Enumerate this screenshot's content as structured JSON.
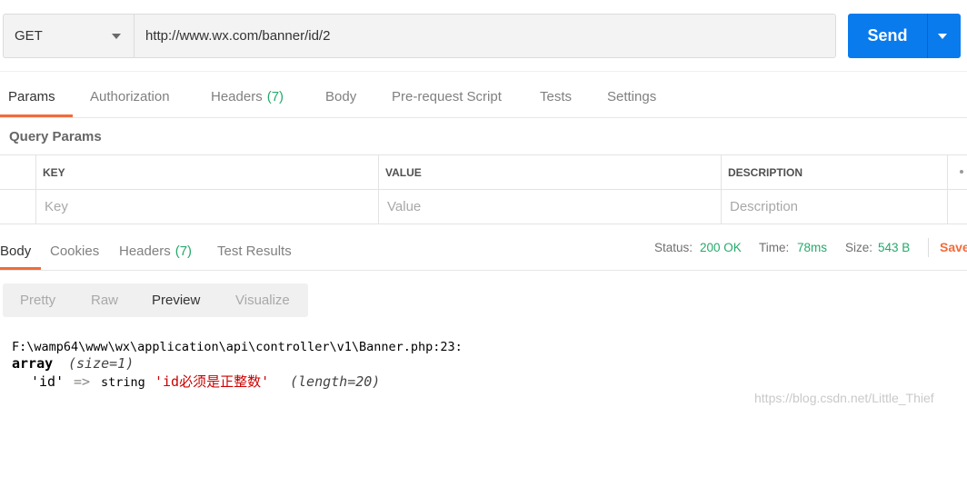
{
  "request": {
    "method": "GET",
    "url": "http://www.wx.com/banner/id/2",
    "send_label": "Send"
  },
  "request_tabs": [
    {
      "label": "Params",
      "active": true
    },
    {
      "label": "Authorization"
    },
    {
      "label": "Headers",
      "count": "(7)"
    },
    {
      "label": "Body"
    },
    {
      "label": "Pre-request Script"
    },
    {
      "label": "Tests"
    },
    {
      "label": "Settings"
    }
  ],
  "query_params": {
    "title": "Query Params",
    "columns": [
      "KEY",
      "VALUE",
      "DESCRIPTION"
    ],
    "placeholders": {
      "key": "Key",
      "value": "Value",
      "description": "Description"
    }
  },
  "response_tabs": [
    {
      "label": "Body",
      "active": true
    },
    {
      "label": "Cookies"
    },
    {
      "label": "Headers",
      "count": "(7)"
    },
    {
      "label": "Test Results"
    }
  ],
  "response_meta": {
    "status_label": "Status:",
    "status_value": "200 OK",
    "time_label": "Time:",
    "time_value": "78ms",
    "size_label": "Size:",
    "size_value": "543 B",
    "save_label": "Save"
  },
  "view_modes": [
    {
      "label": "Pretty"
    },
    {
      "label": "Raw"
    },
    {
      "label": "Preview",
      "active": true
    },
    {
      "label": "Visualize"
    }
  ],
  "preview": {
    "file_line": "F:\\wamp64\\www\\wx\\application\\api\\controller\\v1\\Banner.php:23:",
    "array_keyword": "array",
    "array_size": "(size=1)",
    "key": "'id'",
    "arrow": "=>",
    "value_type": "string",
    "value": "'id必须是正整数'",
    "value_length": "(length=20)"
  },
  "watermark": "https://blog.csdn.net/Little_Thief",
  "icons": {
    "method_dropdown": "chevron-down-icon",
    "send_dropdown": "caret-down-icon",
    "table_menu": "more-horizontal-icon"
  },
  "colors": {
    "accent": "#097bed",
    "active_tab": "#f26b3a",
    "success": "#26a96c",
    "preview_string": "#cc0000",
    "preview_arrow": "#888a85"
  }
}
